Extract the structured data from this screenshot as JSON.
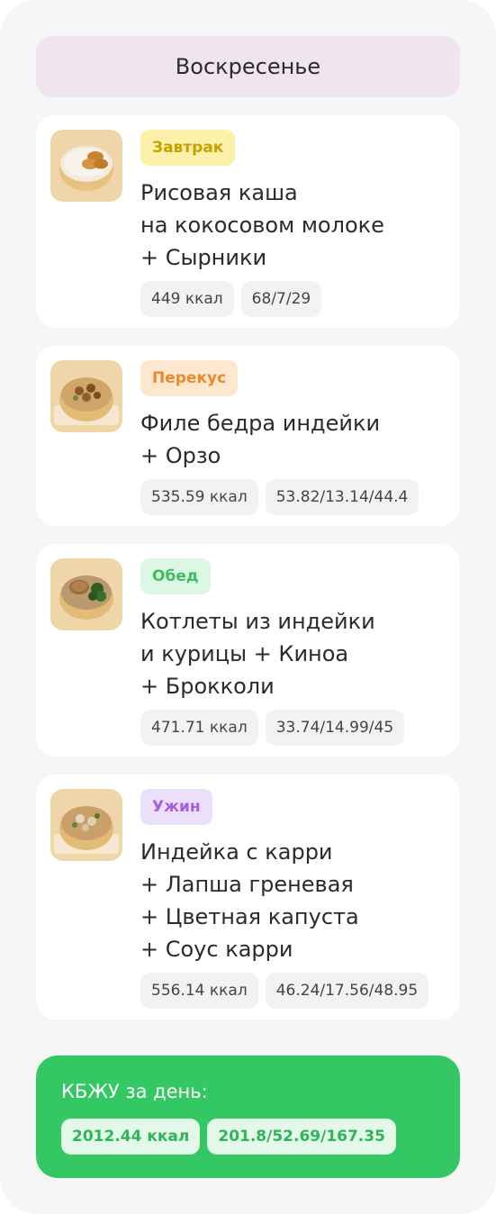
{
  "day": {
    "title": "Воскресенье"
  },
  "meals": [
    {
      "tag": "Завтрак",
      "dish_lines": [
        "Рисовая каша",
        "на кокосовом молоке",
        "+ Сырники"
      ],
      "kcal": "449 ккал",
      "macros": "68/7/29",
      "image_icon": "bowl-porridge-icon"
    },
    {
      "tag": "Перекус",
      "dish_lines": [
        "Филе бедра индейки",
        "+ Орзо"
      ],
      "kcal": "535.59 ккал",
      "macros": "53.82/13.14/44.4",
      "image_icon": "bowl-orzo-icon"
    },
    {
      "tag": "Обед",
      "dish_lines": [
        "Котлеты из индейки",
        "и курицы + Киноа",
        "+ Брокколи"
      ],
      "kcal": "471.71 ккал",
      "macros": "33.74/14.99/45",
      "image_icon": "bowl-cutlet-icon"
    },
    {
      "tag": "Ужин",
      "dish_lines": [
        "Индейка с карри",
        "+ Лапша греневая",
        "+ Цветная капуста",
        "+ Соус карри"
      ],
      "kcal": "556.14 ккал",
      "macros": "46.24/17.56/48.95",
      "image_icon": "bowl-curry-icon"
    }
  ],
  "summary": {
    "title": "КБЖУ за день:",
    "kcal": "2012.44 ккал",
    "macros": "201.8/52.69/167.35"
  },
  "colors": {
    "accent_green": "#34c865",
    "breakfast": "#c9a000",
    "snack": "#e98a2b",
    "lunch": "#3dbe60",
    "dinner": "#a45fe3"
  }
}
